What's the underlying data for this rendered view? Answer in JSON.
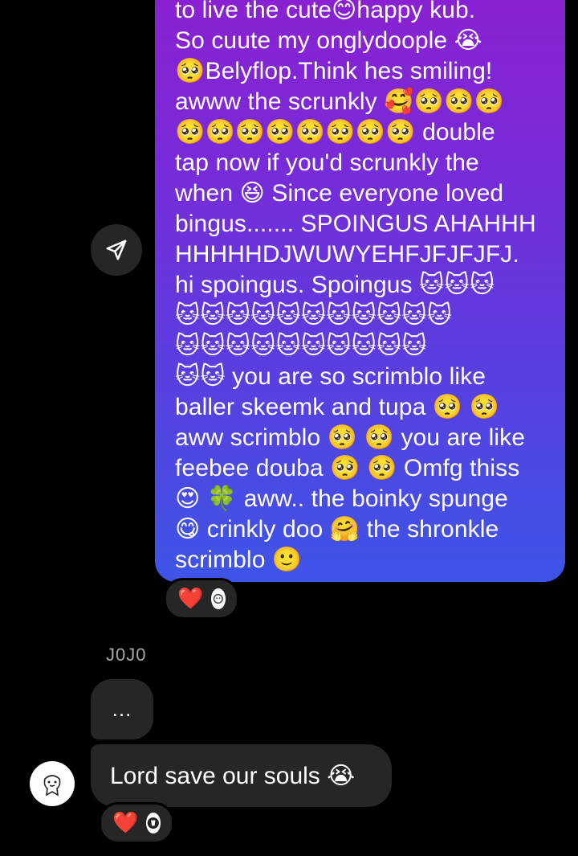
{
  "outgoing_message": {
    "lines": [
      "to live the cute😊happy kub.",
      "So cuute my onglydoople 😭",
      "🥺Belyflop.Think hes smiling!",
      "awww the scrunkly 🥰🥺🥺🥺",
      "🥺🥺🥺🥺🥺🥺🥺🥺 double",
      "tap now if you'd scrunkly the",
      "when 😆 Since everyone loved",
      "bingus....... SPOINGUS AHAHHH",
      "HHHHHDJWUWYEHFJFJFJFJ.",
      "hi spoingus. Spoingus 🐱🐱🐱",
      "🐱🐱🐱🐱🐱🐱🐱🐱🐱🐱🐱",
      "🐱🐱🐱🐱🐱🐱🐱🐱🐱🐱",
      "🐱🐱 you are so scrimblo like",
      "baller skeemk and tupa 🥺 🥺",
      "aww scrimblo 🥺 🥺 you are like",
      "feebee douba 🥺 🥺 Omfg thiss",
      "😍 🍀 aww.. the boinky spunge",
      "😋 crinkly doo 🤗 the shronkle",
      "scrimblo 🙂"
    ],
    "reaction": "❤️"
  },
  "incoming": {
    "sender_name": "J0J0",
    "typing_text": "...",
    "message_text": "Lord save our souls 😭",
    "reaction": "❤️"
  },
  "icons": {
    "share": "paper-plane-icon"
  },
  "colors": {
    "background": "#000000",
    "incoming_bubble": "#262626",
    "outgoing_gradient_top": "#8c1fd0",
    "outgoing_gradient_bottom": "#3d55e6",
    "sender_name": "#a8a8a8",
    "heart": "#ff2a3d"
  }
}
